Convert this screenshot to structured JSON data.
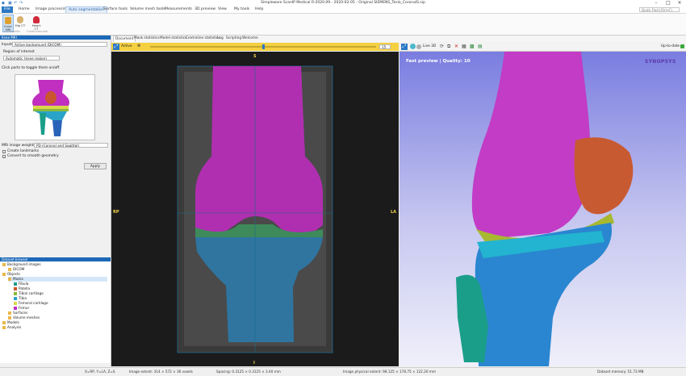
{
  "window": {
    "title": "Simpleware ScanIP Medical R-2020.09 - 2020-02-05 - Original SIEMENS_Tesla_CoronalS.sip"
  },
  "menu": [
    "File",
    "Home",
    "Image processing",
    "Auto segmentation",
    "Surface tools",
    "Volume mesh tools",
    "Measurements",
    "3D preview",
    "View",
    "My tools",
    "Help"
  ],
  "search": {
    "placeholder": "Quick Find (Ctrl+F)"
  },
  "ribbon": {
    "buttons": [
      "Knee MRI",
      "Hip CT",
      "Heart CT"
    ],
    "groups": [
      "Orthopedic",
      "Cardiovascular"
    ]
  },
  "left_panel": {
    "header": "Knee MRI",
    "inputs_label": "Inputs:",
    "inputs_value": "Active background (DICOM)",
    "roi_label": "Region of interest",
    "roi_value": "Automatic (knee region)",
    "toggle_hint": "Click parts to toggle them on/off.",
    "weighting_label": "MRI image weighting:",
    "weighting_value": "PD (Coronal and Sagittal)",
    "create_landmarks": "Create landmarks",
    "convert_smooth": "Convert to smooth geometry",
    "apply": "Apply"
  },
  "dataset_browser": {
    "header": "Dataset browser",
    "items": [
      {
        "label": "Background images",
        "level": 0
      },
      {
        "label": "DICOM",
        "level": 1
      },
      {
        "label": "Objects",
        "level": 0
      },
      {
        "label": "Masks",
        "level": 1
      },
      {
        "label": "Fibula",
        "level": 2,
        "color": "#1a9e8a"
      },
      {
        "label": "Patella",
        "level": 2,
        "color": "#c9562e"
      },
      {
        "label": "Tibial cartilage",
        "level": 2,
        "color": "#88b83a"
      },
      {
        "label": "Tibia",
        "level": 2,
        "color": "#2aa3c8"
      },
      {
        "label": "Femoral cartilage",
        "level": 2,
        "color": "#d8d848"
      },
      {
        "label": "Femur",
        "level": 2,
        "color": "#c02fc0"
      },
      {
        "label": "Surfaces",
        "level": 1
      },
      {
        "label": "Volume meshes",
        "level": 1
      },
      {
        "label": "Models",
        "level": 0
      },
      {
        "label": "Analysis",
        "level": 0
      }
    ]
  },
  "tabs": [
    "Document",
    "Mask statistics",
    "Model statistics",
    "Centreline statistics",
    "Log",
    "Scripting",
    "Welcome"
  ],
  "slice_toolbar": {
    "mode": "Active",
    "slice_number": "15"
  },
  "slice_view": {
    "top": "S",
    "bottom": "I",
    "left": "RP",
    "right": "LA"
  },
  "threed_toolbar": {
    "live_label": "Live 3D",
    "status": "Up-to-date"
  },
  "threed_view": {
    "preview_label": "Fast preview | Quality: 10",
    "brand": "SYNOPSYS"
  },
  "status": {
    "coords": "X=RP, Y=LA, Z=S",
    "extent": "Image extent: 314 × 572 × 36 voxels",
    "spacing": "Spacing: 0.3125 × 0.3125 × 3.40 mm",
    "physical": "Image physical extent: 98.125 × 178.75 × 122.20 mm",
    "memory": "Dataset memory: 51.73 MB"
  },
  "colors": {
    "accent": "#1c69b8",
    "femur": "#c02fc0",
    "tibia": "#2aa3c8",
    "patella": "#c9562e",
    "fibula": "#1a9e8a",
    "cartilage": "#88b83a"
  }
}
